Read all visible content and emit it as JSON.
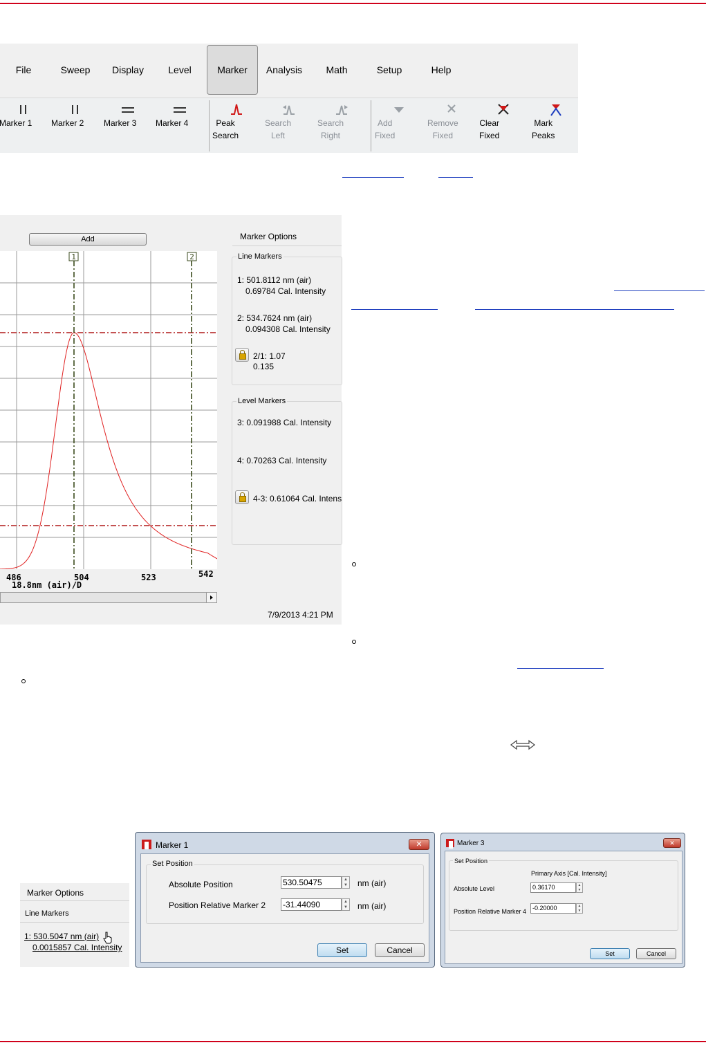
{
  "menu": [
    "File",
    "Sweep",
    "Display",
    "Level",
    "Marker",
    "Analysis",
    "Math",
    "Setup",
    "Help"
  ],
  "menu_active": "Marker",
  "toolbar": {
    "marker1": "Marker 1",
    "marker2": "Marker 2",
    "marker3": "Marker 3",
    "marker4": "Marker 4",
    "peak_search": "Peak\nSearch",
    "search_left": "Search\nLeft",
    "search_right": "Search\nRight",
    "add_fixed": "Add\nFixed",
    "remove_fixed": "Remove\nFixed",
    "clear_fixed": "Clear\nFixed",
    "mark_peaks": "Mark\nPeaks"
  },
  "chart": {
    "add_button": "Add",
    "marker_options": "Marker Options",
    "line_markers_title": "Line Markers",
    "lm1_line1": "1:    501.8112 nm (air)",
    "lm1_line2": "0.69784 Cal. Intensity",
    "lm2_line1": "2:    534.7624 nm (air)",
    "lm2_line2": "0.094308 Cal. Intensity",
    "lm_ratio1": "2/1: 1.07",
    "lm_ratio2": "0.135",
    "level_markers_title": "Level Markers",
    "lv3": "3:    0.091988 Cal. Intensity",
    "lv4": "4:    0.70263 Cal. Intensity",
    "lv_diff": "4-3: 0.61064 Cal. Intens",
    "x_ticks": [
      "486",
      "504",
      "523",
      "542"
    ],
    "x_scale": "18.8nm (air)/D",
    "line_marker_tags": [
      "1",
      "2"
    ],
    "timestamp": "7/9/2013 4:21 PM"
  },
  "panel_small": {
    "marker_options": "Marker Options",
    "line_markers_title": "Line Markers",
    "line1": "1:    530.5047 nm (air)",
    "line2": "0.0015857 Cal. Intensity"
  },
  "dialog1": {
    "title": "Marker 1",
    "close": "✕",
    "group": "Set Position",
    "abs_label": "Absolute Position",
    "abs_value": "530.50475",
    "abs_unit": "nm (air)",
    "rel_label": "Position Relative Marker 2",
    "rel_value": "-31.44090",
    "rel_unit": "nm (air)",
    "set": "Set",
    "cancel": "Cancel"
  },
  "dialog3": {
    "title": "Marker 3",
    "close": "✕",
    "group": "Set Position",
    "header": "Primary Axis    [Cal. Intensity]",
    "abs_label": "Absolute Level",
    "abs_value": "0.36170",
    "rel_label": "Position Relative Marker 4",
    "rel_value": "-0.20000",
    "set": "Set",
    "cancel": "Cancel"
  },
  "colors": {
    "rule": "#d0021b",
    "curve": "#e02020",
    "level_marker": "#b01818",
    "line_marker": "#3a4a1c"
  }
}
